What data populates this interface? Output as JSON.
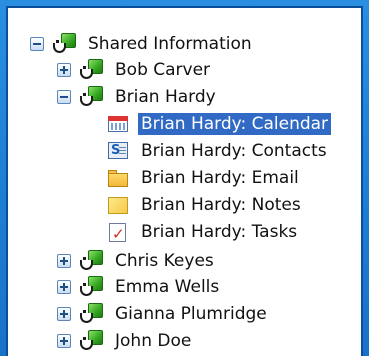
{
  "tree": {
    "root": {
      "label": "Shared Information",
      "expanded": true
    },
    "users": [
      {
        "label": "Bob Carver",
        "expanded": false
      },
      {
        "label": "Brian Hardy",
        "expanded": true,
        "folders": [
          {
            "label": "Brian Hardy: Calendar",
            "icon": "calendar-icon",
            "selected": true
          },
          {
            "label": "Brian Hardy: Contacts",
            "icon": "contacts-icon"
          },
          {
            "label": "Brian Hardy: Email",
            "icon": "email-folder-icon"
          },
          {
            "label": "Brian Hardy: Notes",
            "icon": "notes-icon"
          },
          {
            "label": "Brian Hardy: Tasks",
            "icon": "tasks-icon"
          }
        ]
      },
      {
        "label": "Chris Keyes",
        "expanded": false
      },
      {
        "label": "Emma Wells",
        "expanded": false
      },
      {
        "label": "Gianna Plumridge",
        "expanded": false
      },
      {
        "label": "John Doe",
        "expanded": false
      }
    ]
  },
  "colors": {
    "background": "#1f7fd6",
    "selection": "#316ac5",
    "shared_icon_green": "#33a51f"
  }
}
